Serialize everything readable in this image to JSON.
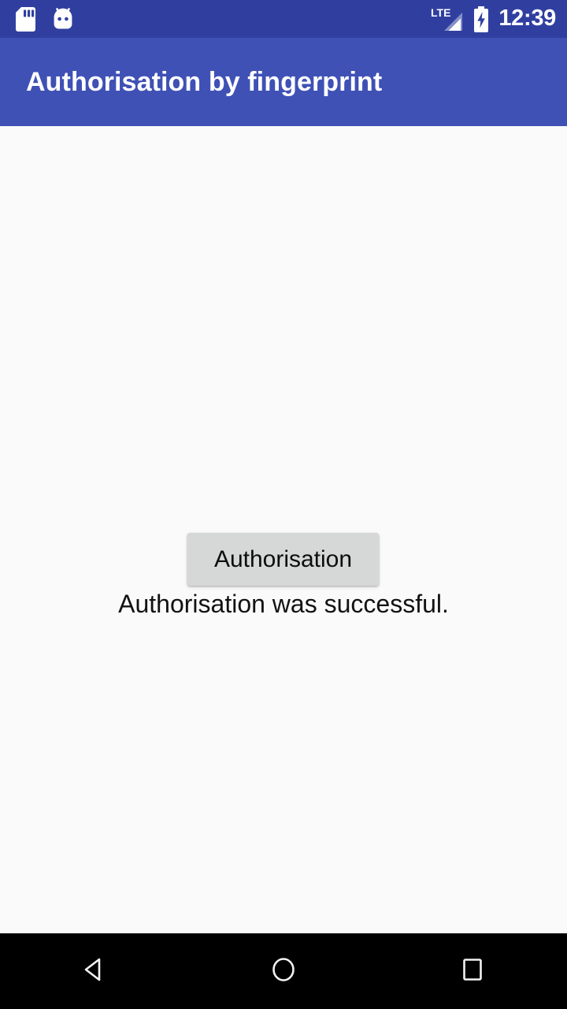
{
  "status_bar": {
    "background_color": "#303F9F",
    "clock": "12:39",
    "left_icons": [
      {
        "name": "sd-card-icon",
        "label": "SD card"
      },
      {
        "name": "android-head-icon",
        "label": "Android system"
      }
    ],
    "right_icons": [
      {
        "name": "lte-signal-icon",
        "label": "LTE",
        "network_type": "LTE"
      },
      {
        "name": "battery-charging-icon",
        "label": "Battery charging"
      }
    ]
  },
  "app_bar": {
    "title": "Authorisation by fingerprint",
    "background_color": "#3F51B5",
    "text_color": "#FFFFFF"
  },
  "content": {
    "background_color": "#FAFAFA",
    "status_message": "Authorisation was successful.",
    "authorisation_button": {
      "label": "Authorisation",
      "background_color": "#D6D7D7",
      "text_color": "#0D0D0D"
    }
  },
  "nav_bar": {
    "background_color": "#000000",
    "buttons": [
      {
        "name": "nav-back-button",
        "label": "Back"
      },
      {
        "name": "nav-home-button",
        "label": "Home"
      },
      {
        "name": "nav-recents-button",
        "label": "Recents"
      }
    ]
  }
}
